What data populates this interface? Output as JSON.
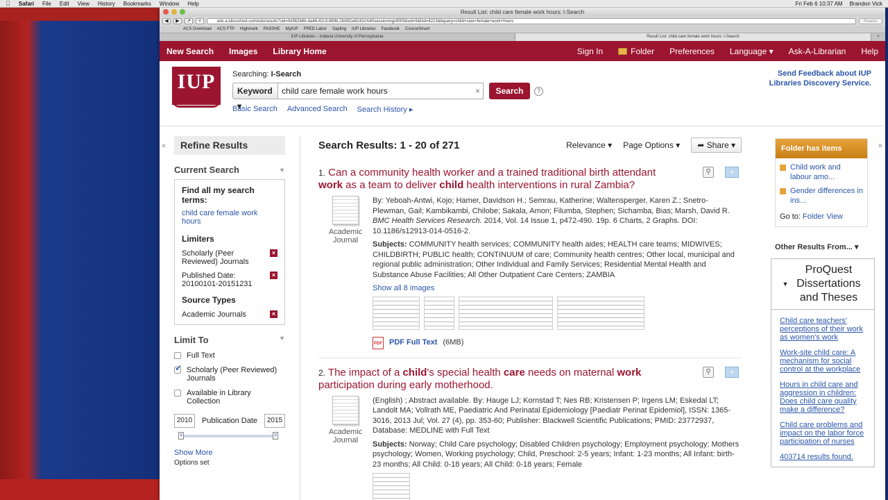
{
  "menubar": {
    "app": "Safari",
    "items": [
      "File",
      "Edit",
      "View",
      "History",
      "Bookmarks",
      "Window",
      "Help"
    ],
    "clock": "Fri Feb 6  10:37 AM",
    "user": "Brandon Vick"
  },
  "browser": {
    "title": "Result List: child care female work hours: I-Search",
    "url": "eds.a.ebscohost.com/eds/results?sid=0e562b6b-4a46-42c3-869b-2fe931e6142c%40sessionmgr4003&vid=5&hid=4213&bquery=child+care+female+work+hours",
    "reader": "Reader",
    "bookmarks": [
      "ACS Download",
      "ACS FTP",
      "Highmark",
      "PASSHE",
      "MyIUP",
      "FRED Labor",
      "Sapling",
      "IUP Libraries",
      "Facebook",
      "CourseSmart"
    ],
    "tabs": [
      "IUP Libraries – Indiana University of Pennsylvania",
      "Result List: child care female work hours: I-Search"
    ]
  },
  "nav": {
    "left": [
      "New Search",
      "Images",
      "Library Home"
    ],
    "right": [
      "Sign In",
      "Folder",
      "Preferences",
      "Language ▾",
      "Ask-A-Librarian",
      "Help"
    ]
  },
  "header": {
    "logo": "IUP",
    "searching_label": "Searching:",
    "searching_value": "I-Search",
    "field": "Keyword",
    "query": "child care female work hours",
    "search_button": "Search",
    "links": [
      "Basic Search",
      "Advanced Search",
      "Search History ▸"
    ],
    "feedback_line1": "Send Feedback about IUP",
    "feedback_line2": "Libraries Discovery Service."
  },
  "left": {
    "refine": "Refine Results",
    "current_search": "Current Search",
    "find_all": "Find all my search terms:",
    "term": "child care female work hours",
    "limiters_label": "Limiters",
    "limiters": [
      "Scholarly (Peer Reviewed) Journals",
      "Published Date: 20100101-20151231"
    ],
    "source_types_label": "Source Types",
    "source_types": [
      "Academic Journals"
    ],
    "limit_to": "Limit To",
    "checks": [
      {
        "label": "Full Text",
        "checked": false
      },
      {
        "label": "Scholarly (Peer Reviewed) Journals",
        "checked": true
      },
      {
        "label": "Available in Library Collection",
        "checked": false
      }
    ],
    "pub_from": "2010",
    "pub_label": "Publication Date",
    "pub_to": "2015",
    "show_more": "Show More",
    "options_set": "Options set"
  },
  "results": {
    "heading": "Search Results: 1 - 20 of 271",
    "relevance": "Relevance ▾",
    "page_options": "Page Options ▾",
    "share": "Share ▾",
    "items": [
      {
        "num": "1.",
        "type": "Academic Journal",
        "byline": "By: Yeboah-Antwi, Kojo; Hamer, Davidson H.; Semrau, Katherine; Waltensperger, Karen Z.; Snetro-Plewman, Gail; Kambikambi, Chilobe; Sakala, Amon; Filumba, Stephen; Sichamba, Bias; Marsh, David R.",
        "journal": "BMC Health Services Research.",
        "details": "2014, Vol. 14 Issue 1, p472-490. 19p. 6 Charts, 2 Graphs. DOI: 10.1186/s12913-014-0516-2.",
        "subjects_label": "Subjects:",
        "subjects": "COMMUNITY health services; COMMUNITY health aides; HEALTH care teams; MIDWIVES; CHILDBIRTH; PUBLIC health; CONTINUUM of care; Community health centres; Other local, municipal and regional public administration; Other Individual and Family Services; Residential Mental Health and Substance Abuse Facilities; All Other Outpatient Care Centers; ZAMBIA",
        "images_link": "Show all 8 images",
        "pdf": "PDF Full Text",
        "pdf_size": "(6MB)"
      },
      {
        "num": "2.",
        "type": "Academic Journal",
        "byline": "(English) ; Abstract available. By: Hauge LJ; Kornstad T; Nes RB; Kristensen P; Irgens LM; Eskedal LT; Landolt MA; Vollrath ME, Paediatric And Perinatal Epidemiology [Paediatr Perinat Epidemiol], ISSN: 1365-3016, 2013 Jul; Vol. 27 (4), pp. 353-60; Publisher: Blackwell Scientific Publications; PMID: 23772937, Database: MEDLINE with Full Text",
        "subjects_label": "Subjects:",
        "subjects": "Norway; Child Care psychology; Disabled Children psychology; Employment psychology; Mothers psychology; Women, Working psychology; Child, Preschool: 2-5 years; Infant: 1-23 months; All Infant: birth-23 months; All Child: 0-18 years; All Child: 0-18 years; Female"
      }
    ]
  },
  "right": {
    "folder_head": "Folder has items",
    "folder_items": [
      "Child work and labour amo...",
      "Gender differences in ins..."
    ],
    "goto_label": "Go to:",
    "goto_link": "Folder View",
    "other_results": "Other Results From... ▾",
    "pq_title": "ProQuest Dissertations and Theses",
    "pq_links": [
      "Child care teachers' perceptions of their work as women's work",
      "Work-site child care: A mechanism for social control at the workplace",
      "Hours in child care and aggression in children: Does child care quality make a difference?",
      "Child care problems and impact on the labor force participation of nurses",
      "403714 results found."
    ]
  },
  "colors": {
    "brand": "#9b1530",
    "link": "#2a55a8",
    "folder": "#e0a03a"
  }
}
